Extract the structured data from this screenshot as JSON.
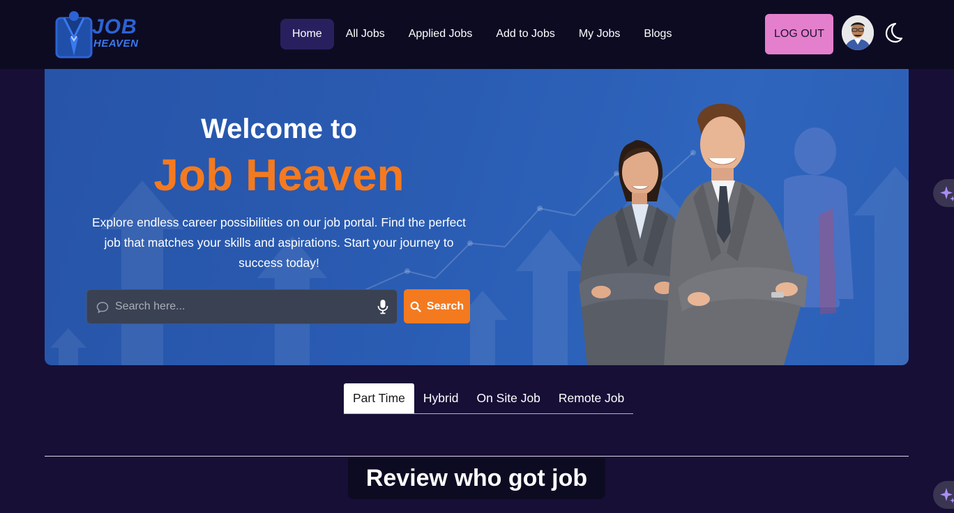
{
  "brand": {
    "logo_word_1": "JOB",
    "logo_word_2": "HEAVEN",
    "accent_color": "#f47a1f",
    "nav_bg": "#0d0b22",
    "page_bg": "#170f36"
  },
  "nav": {
    "items": [
      {
        "label": "Home",
        "active": true
      },
      {
        "label": "All Jobs",
        "active": false
      },
      {
        "label": "Applied Jobs",
        "active": false
      },
      {
        "label": "Add to Jobs",
        "active": false
      },
      {
        "label": "My Jobs",
        "active": false
      },
      {
        "label": "Blogs",
        "active": false
      }
    ],
    "logout_label": "LOG OUT",
    "logout_color": "#e47fcd",
    "theme_icon": "moon-icon",
    "avatar_icon": "user-avatar"
  },
  "hero": {
    "title": "Welcome to",
    "brand": "Job Heaven",
    "description": "Explore endless career possibilities on our job portal. Find the perfect job that matches your skills and aspirations. Start your journey to success today!",
    "search": {
      "placeholder": "Search here...",
      "value": "",
      "button_label": "Search",
      "left_icon": "chat-bubble-icon",
      "mic_icon": "microphone-icon",
      "button_icon": "search-icon"
    }
  },
  "tabs": {
    "items": [
      "Part Time",
      "Hybrid",
      "On Site Job",
      "Remote Job"
    ],
    "active_index": 0
  },
  "reviews": {
    "title": "Review who got job"
  },
  "side_buttons": {
    "icon": "sparkle-icon"
  }
}
